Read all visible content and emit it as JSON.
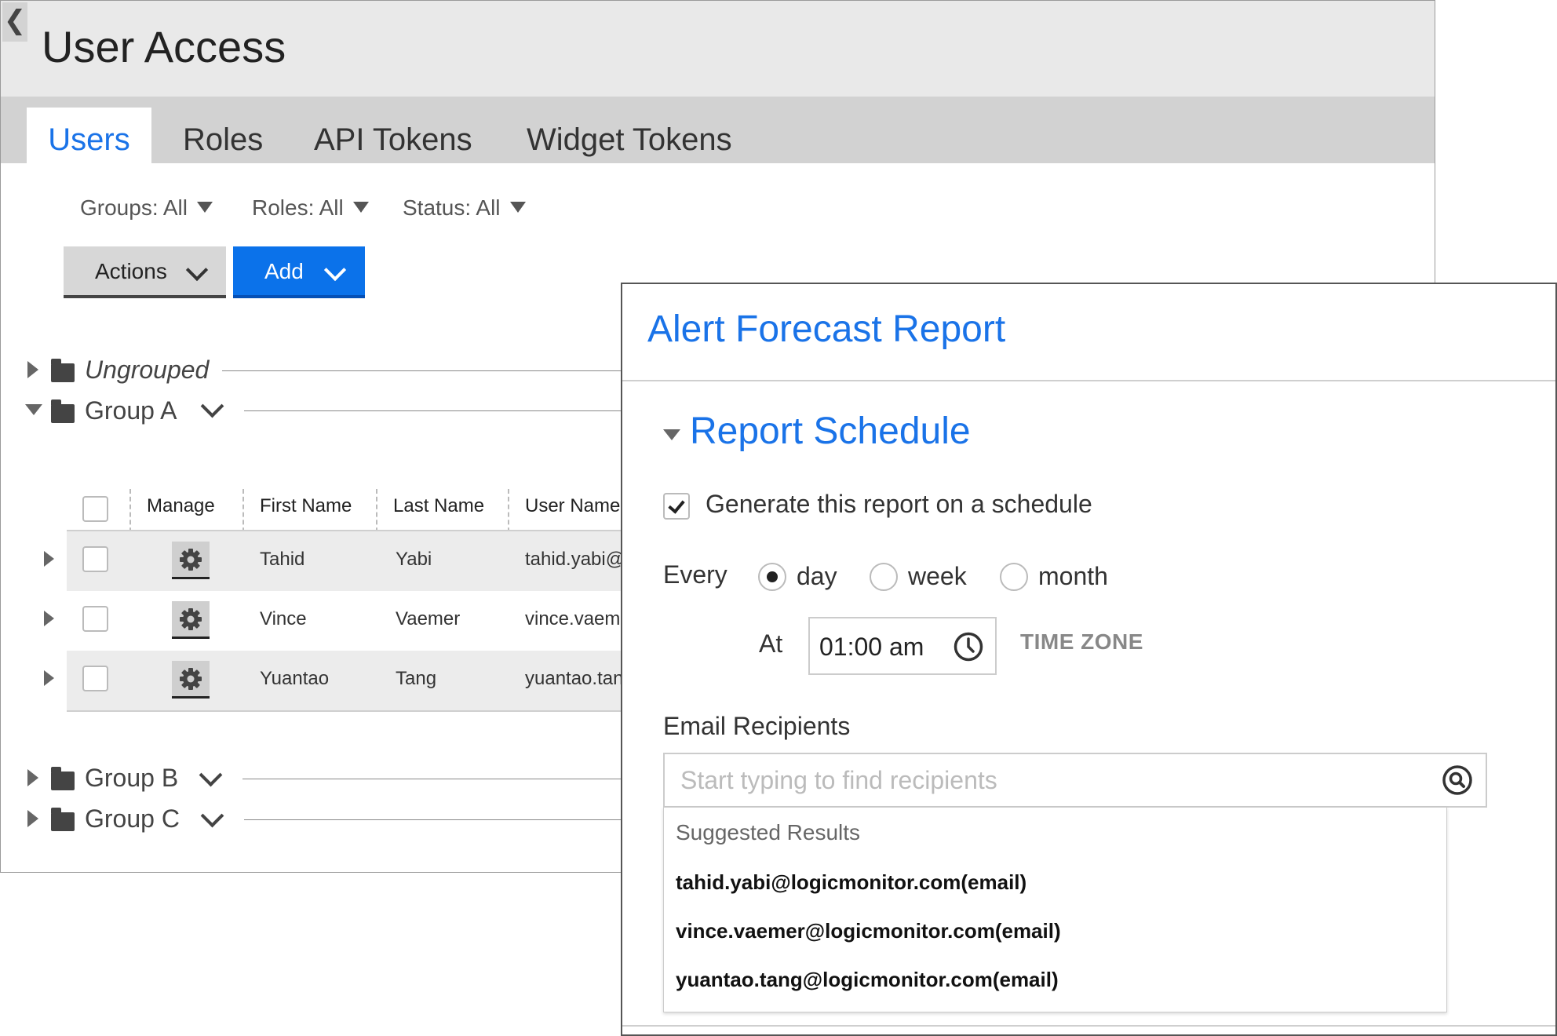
{
  "user_access": {
    "back_glyph": "❮",
    "title": "User Access",
    "tabs": [
      "Users",
      "Roles",
      "API Tokens",
      "Widget Tokens"
    ],
    "active_tab": "Users",
    "filters": [
      "Groups: All",
      "Roles: All",
      "Status: All"
    ],
    "actions_label": "Actions",
    "add_label": "Add",
    "groups": [
      {
        "label": "Ungrouped",
        "expanded": false
      },
      {
        "label": "Group A",
        "expanded": true
      },
      {
        "label": "Group B",
        "expanded": false
      },
      {
        "label": "Group C",
        "expanded": false
      }
    ],
    "table": {
      "headers": [
        "Manage",
        "First Name",
        "Last Name",
        "User Name"
      ],
      "rows": [
        {
          "first": "Tahid",
          "last": "Yabi",
          "username": "tahid.yabi@"
        },
        {
          "first": "Vince",
          "last": "Vaemer",
          "username": "vince.vaem"
        },
        {
          "first": "Yuantao",
          "last": "Tang",
          "username": "yuantao.tan"
        }
      ]
    }
  },
  "report_panel": {
    "title": "Alert Forecast Report",
    "section_title": "Report Schedule",
    "schedule_checkbox_label": "Generate this report on a schedule",
    "schedule_checked": true,
    "every_label": "Every",
    "frequency_options": [
      "day",
      "week",
      "month"
    ],
    "frequency_selected": "day",
    "at_label": "At",
    "time_value": "01:00 am",
    "timezone_label": "TIME ZONE",
    "email_label": "Email Recipients",
    "email_placeholder": "Start typing to find recipients",
    "suggestions_title": "Suggested Results",
    "suggestions": [
      "tahid.yabi@logicmonitor.com(email)",
      "vince.vaemer@logicmonitor.com(email)",
      "yuantao.tang@logicmonitor.com(email)"
    ]
  },
  "colors": {
    "accent_blue": "#1a73e8",
    "add_button_blue": "#0b72ea",
    "header_gray": "#e9e9e9",
    "tabbar_gray": "#d2d2d2",
    "row_stripe": "#ececec"
  },
  "icons": [
    "back-chevron-icon",
    "filter-dropdown-icon",
    "chevron-down-icon",
    "folder-icon",
    "expand-triangle-icon",
    "gear-icon",
    "checkbox-icon",
    "clock-icon",
    "search-icon"
  ]
}
